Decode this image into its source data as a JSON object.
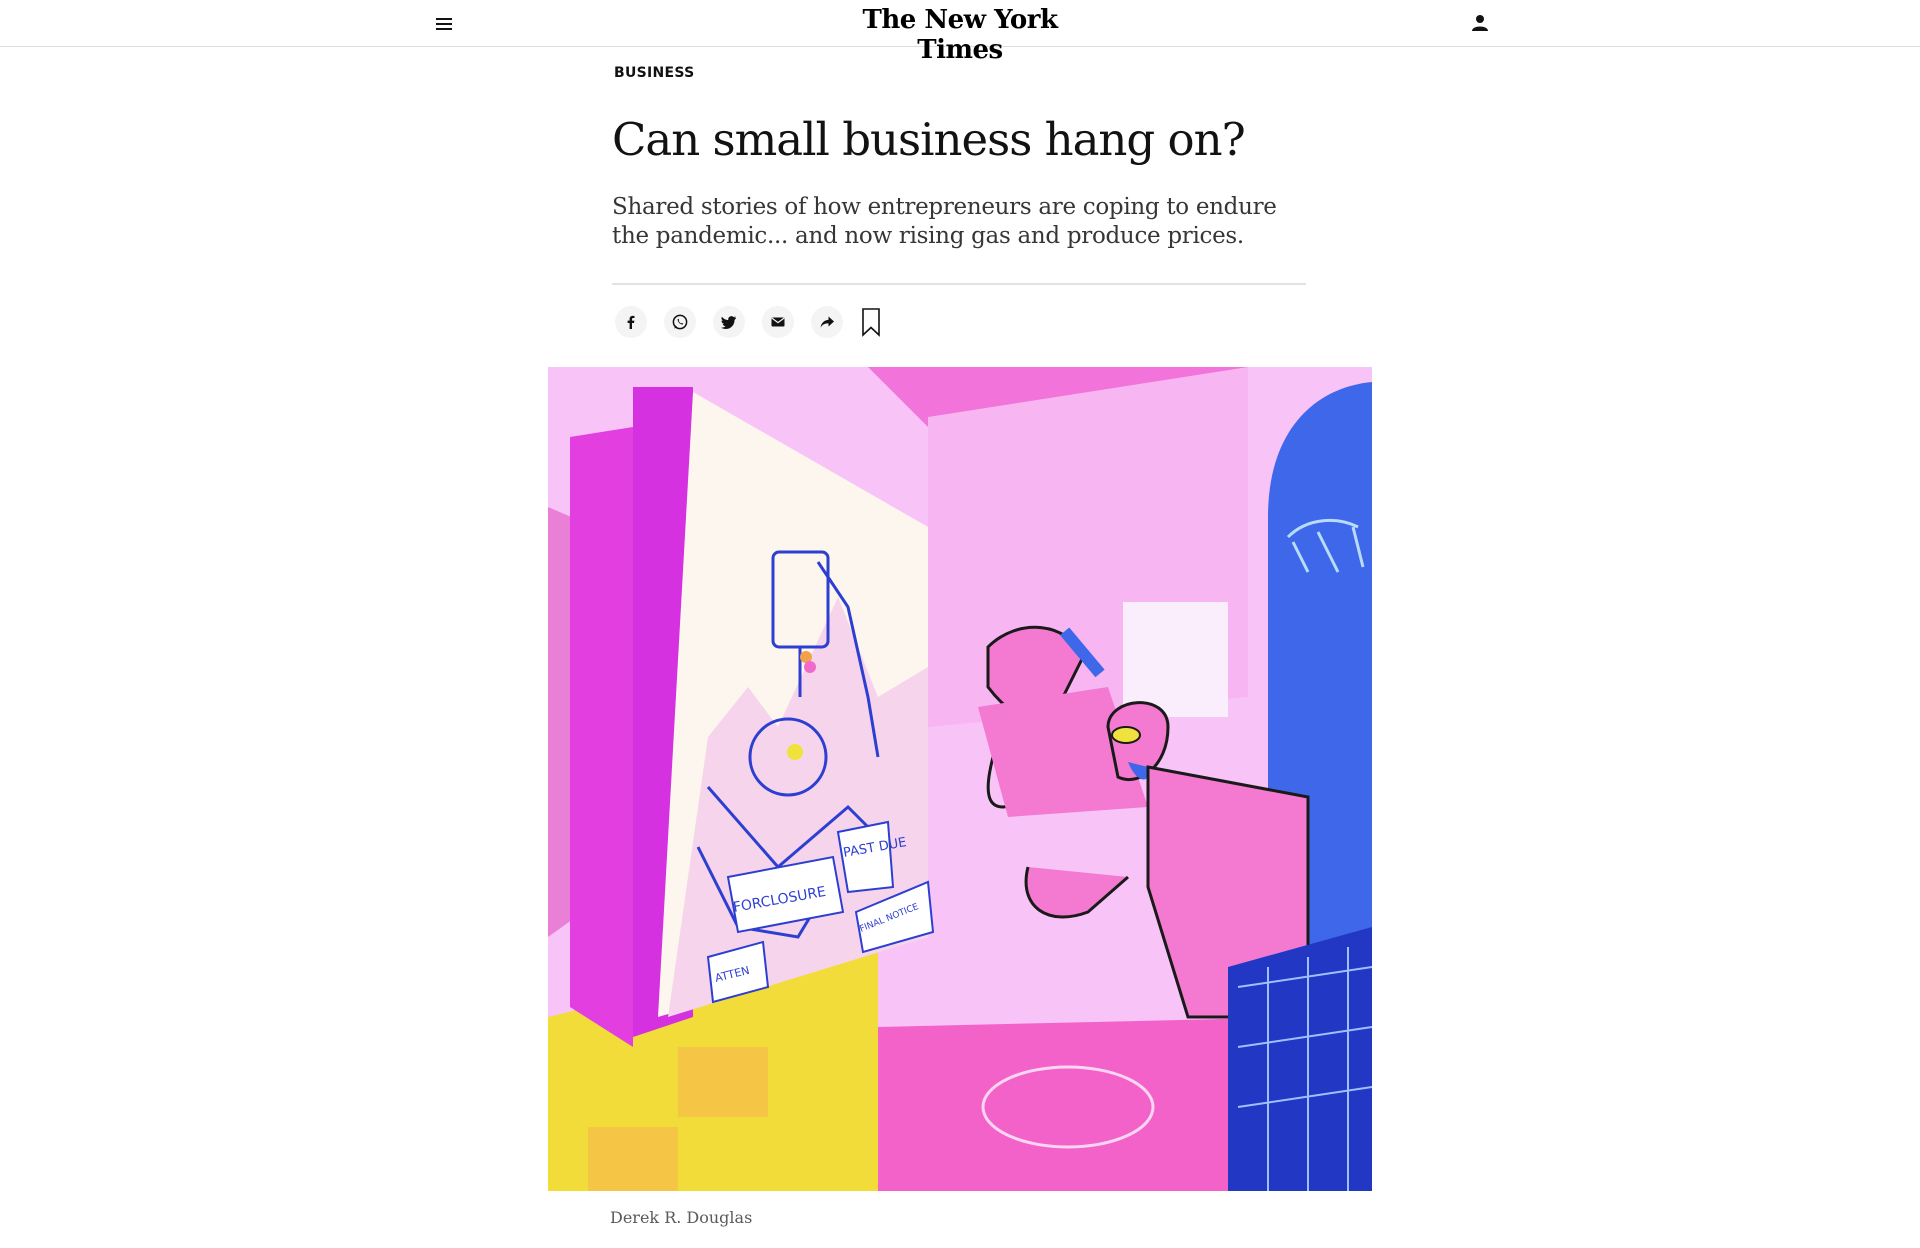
{
  "header": {
    "logo": "The New York Times",
    "menu_icon": "hamburger-menu-icon",
    "account_icon": "person-icon"
  },
  "article": {
    "section": "BUSINESS",
    "headline": "Can small business hang on?",
    "summary": "Shared stories of how entrepreneurs are coping to endure the pandemic... and now rising gas and produce prices.",
    "share": {
      "facebook_icon": "facebook-icon",
      "whatsapp_icon": "whatsapp-icon",
      "twitter_icon": "twitter-icon",
      "email_icon": "email-icon",
      "share_icon": "share-arrow-icon",
      "bookmark_icon": "bookmark-icon"
    },
    "image": {
      "signs": {
        "foreclosure": "FORCLOSURE",
        "past_due": "PAST DUE",
        "final_notice": "FINAL NOTICE",
        "attention": "ATTEN"
      }
    },
    "credit": "Derek R. Douglas"
  },
  "colors": {
    "text": "#121212",
    "summary": "#363636",
    "divider": "#e2e2e2",
    "art_pink": "#f8c4f8",
    "art_magenta": "#e23ee0",
    "art_blue": "#3b63e8",
    "art_yellow": "#f0e23c"
  }
}
